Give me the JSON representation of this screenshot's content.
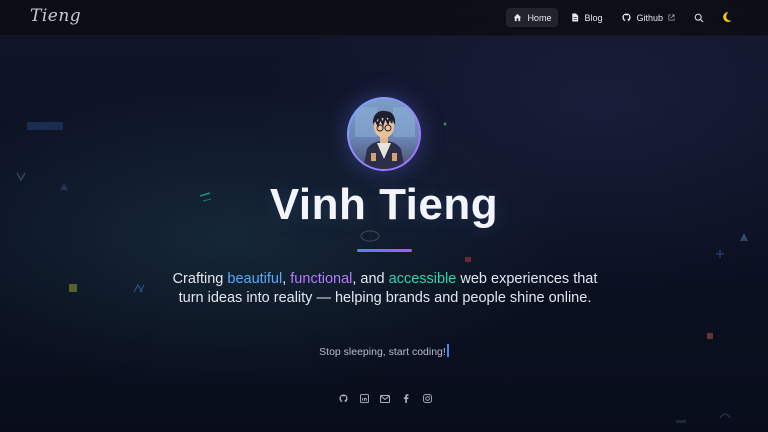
{
  "logo": {
    "text": "Tieng"
  },
  "nav": {
    "home": "Home",
    "blog": "Blog",
    "github": "Github"
  },
  "hero": {
    "name": "Vinh Tieng",
    "tagline": {
      "p1": "Crafting ",
      "w1": "beautiful",
      "p2": ", ",
      "w2": "functional",
      "p3": ", and ",
      "w3": "accessible",
      "p4": " web experiences that turn ideas into reality — helping brands and people shine online."
    },
    "motto": "Stop sleeping, start coding!"
  },
  "colors": {
    "accent_blue": "#5aa9ff",
    "accent_purple": "#b57bff",
    "accent_teal": "#2fd6a8",
    "moon": "#f5c518"
  },
  "icons": {
    "nav": [
      "home-icon",
      "blog-icon",
      "github-icon",
      "external-link-icon",
      "search-icon",
      "moon-icon"
    ],
    "socials": [
      "github-icon",
      "linkedin-icon",
      "mail-icon",
      "facebook-icon",
      "instagram-icon"
    ]
  }
}
